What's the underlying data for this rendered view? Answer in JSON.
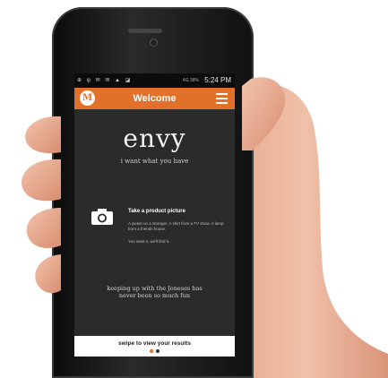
{
  "status": {
    "icons": "⊕ ψ ✉ ✉ ▲ ◪",
    "battery": "4G  38%",
    "time": "5:24 PM"
  },
  "appbar": {
    "logo_letter": "M",
    "title": "Welcome"
  },
  "hero": {
    "brand": "envy",
    "tagline": "i want what you have"
  },
  "product": {
    "title": "Take a product picture",
    "description": "A jacket on a stranger. A shirt from a TV show. A lamp from a friends house.",
    "note": "You want it, we'll find it."
  },
  "slogan": {
    "line1": "keeping up with the Joneses has",
    "line2": "never been so much fun"
  },
  "swipe": {
    "label": "swipe to view your results"
  },
  "colors": {
    "accent": "#e0702a",
    "screen_bg": "#2b2b2b",
    "dot_active": "#e0702a",
    "dot_inactive": "#333333"
  }
}
